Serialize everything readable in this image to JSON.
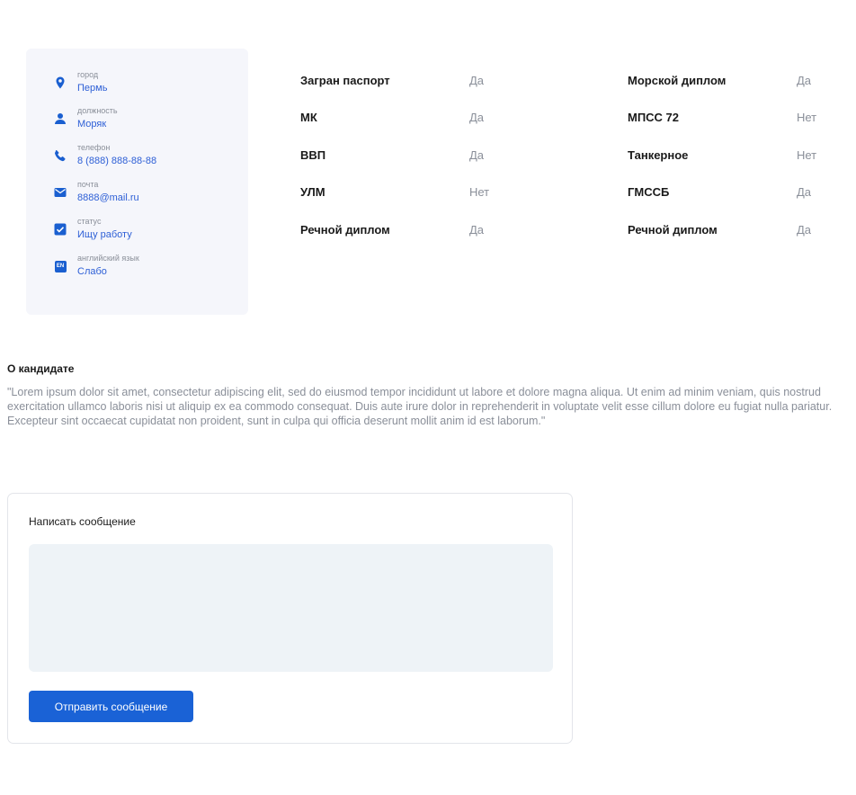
{
  "profile": {
    "items": [
      {
        "label": "город",
        "value": "Пермь",
        "icon": "location-pin-icon"
      },
      {
        "label": "должность",
        "value": "Моряк",
        "icon": "person-icon"
      },
      {
        "label": "телефон",
        "value": "8 (888) 888-88-88",
        "icon": "phone-icon"
      },
      {
        "label": "почта",
        "value": "8888@mail.ru",
        "icon": "mail-icon"
      },
      {
        "label": "статус",
        "value": "Ищу работу",
        "icon": "checkbox-icon"
      },
      {
        "label": "английский язык",
        "value": "Слабо",
        "icon": "en-badge-icon",
        "badge": "EN"
      }
    ]
  },
  "documents": {
    "left": [
      {
        "name": "Загран паспорт",
        "value": "Да"
      },
      {
        "name": "МК",
        "value": "Да"
      },
      {
        "name": "ВВП",
        "value": "Да"
      },
      {
        "name": "УЛМ",
        "value": "Нет"
      },
      {
        "name": "Речной диплом",
        "value": "Да"
      }
    ],
    "right": [
      {
        "name": "Морской диплом",
        "value": "Да"
      },
      {
        "name": "МПСС 72",
        "value": "Нет"
      },
      {
        "name": "Танкерное",
        "value": "Нет"
      },
      {
        "name": "ГМССБ",
        "value": "Да"
      },
      {
        "name": "Речной диплом",
        "value": "Да"
      }
    ]
  },
  "about": {
    "title": "О кандидате",
    "text": "\"Lorem ipsum dolor sit amet, consectetur adipiscing elit, sed do eiusmod tempor incididunt ut labore et dolore magna aliqua. Ut enim ad minim veniam, quis nostrud exercitation ullamco laboris nisi ut aliquip ex ea commodo consequat. Duis aute irure dolor in reprehenderit in voluptate velit esse cillum dolore eu fugiat nulla pariatur. Excepteur sint occaecat cupidatat non proident, sunt in culpa qui officia deserunt mollit anim id est laborum.\""
  },
  "message": {
    "title": "Написать сообщение",
    "placeholder": "",
    "send_label": "Отправить сообщение"
  },
  "colors": {
    "accent": "#1a62d6",
    "link": "#2d5fd6",
    "muted": "#8a8f99",
    "card_bg": "#f5f6fb",
    "textarea_bg": "#eef3f7"
  }
}
